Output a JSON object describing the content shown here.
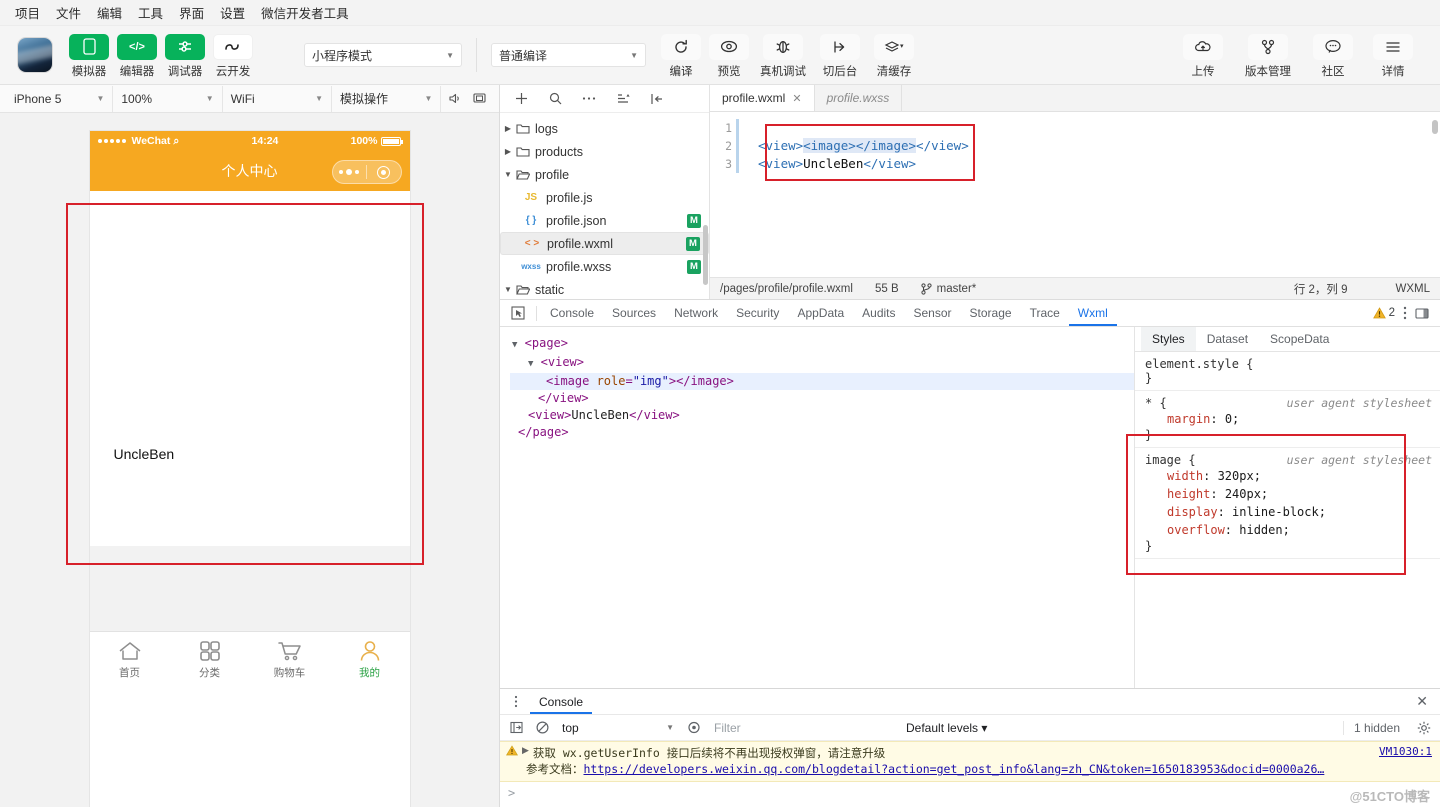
{
  "menubar": {
    "items": [
      "项目",
      "文件",
      "编辑",
      "工具",
      "界面",
      "设置",
      "微信开发者工具"
    ]
  },
  "toolbar": {
    "buttons": [
      {
        "label": "模拟器",
        "icon": "phone-icon",
        "style": "green"
      },
      {
        "label": "编辑器",
        "icon": "code-icon",
        "style": "green"
      },
      {
        "label": "调试器",
        "icon": "debugger-icon",
        "style": "green"
      },
      {
        "label": "云开发",
        "icon": "cloud-dev-icon",
        "style": "white"
      }
    ],
    "mode_select": "小程序模式",
    "compile_select": "普通编译",
    "actions": [
      {
        "label": "编译",
        "icon": "refresh-icon"
      },
      {
        "label": "预览",
        "icon": "eye-icon"
      },
      {
        "label": "真机调试",
        "icon": "remote-debug-icon"
      },
      {
        "label": "切后台",
        "icon": "background-icon"
      },
      {
        "label": "清缓存",
        "icon": "layers-icon"
      }
    ],
    "right_actions": [
      {
        "label": "上传",
        "icon": "upload-cloud-icon"
      },
      {
        "label": "版本管理",
        "icon": "branch-icon"
      },
      {
        "label": "社区",
        "icon": "chat-icon"
      },
      {
        "label": "详情",
        "icon": "menu-icon"
      }
    ]
  },
  "simulator": {
    "device": "iPhone 5",
    "zoom": "100%",
    "network": "WiFi",
    "operation": "模拟操作",
    "icons": [
      "volume-icon",
      "screen-icon"
    ],
    "phone": {
      "carrier": "WeChat",
      "time": "14:24",
      "battery": "100%",
      "nav_title": "个人中心",
      "body_text": "UncleBen",
      "tabs": [
        {
          "label": "首页",
          "icon": "home-icon",
          "active": false
        },
        {
          "label": "分类",
          "icon": "grid-icon",
          "active": false
        },
        {
          "label": "购物车",
          "icon": "cart-icon",
          "active": false
        },
        {
          "label": "我的",
          "icon": "user-icon",
          "active": true
        }
      ]
    }
  },
  "filetree": {
    "tools": [
      "plus-icon",
      "search-icon",
      "more-icon",
      "sort-icon",
      "collapse-icon"
    ],
    "nodes": [
      {
        "name": "logs",
        "type": "folder",
        "expanded": false,
        "depth": 1,
        "badge": ""
      },
      {
        "name": "products",
        "type": "folder",
        "expanded": false,
        "depth": 1,
        "badge": ""
      },
      {
        "name": "profile",
        "type": "folder",
        "expanded": true,
        "depth": 1,
        "badge": ""
      },
      {
        "name": "profile.js",
        "type": "js",
        "ext": "JS",
        "depth": 2,
        "badge": ""
      },
      {
        "name": "profile.json",
        "type": "json",
        "ext": "{ }",
        "depth": 2,
        "badge": "M"
      },
      {
        "name": "profile.wxml",
        "type": "wxml",
        "ext": "< >",
        "depth": 2,
        "badge": "M",
        "selected": true
      },
      {
        "name": "profile.wxss",
        "type": "wxss",
        "ext": "wxss",
        "depth": 2,
        "badge": "M"
      },
      {
        "name": "static",
        "type": "folder",
        "expanded": true,
        "depth": 0,
        "badge": ""
      }
    ]
  },
  "editor": {
    "tabs": [
      {
        "label": "profile.wxml",
        "active": true,
        "closable": true
      },
      {
        "label": "profile.wxss",
        "active": false,
        "preview": true
      }
    ],
    "lines": [
      {
        "no": "1",
        "text": ""
      },
      {
        "no": "2",
        "text": "<view><image></image></view>"
      },
      {
        "no": "3",
        "text": "<view>UncleBen</view>"
      }
    ],
    "status": {
      "path": "/pages/profile/profile.wxml",
      "size": "55 B",
      "branch": "master*",
      "cursor": "行 2，列 9",
      "language": "WXML"
    }
  },
  "devtools": {
    "tabs": [
      "Console",
      "Sources",
      "Network",
      "Security",
      "AppData",
      "Audits",
      "Sensor",
      "Storage",
      "Trace",
      "Wxml"
    ],
    "active_tab": "Wxml",
    "warning_count": "2",
    "dom": [
      {
        "indent": 0,
        "tri": "▼",
        "text": "<page>",
        "hl": false
      },
      {
        "indent": 1,
        "tri": "▼",
        "text": "<view>",
        "hl": false
      },
      {
        "indent": 2,
        "tri": "",
        "text": "<image role=\"img\"></image>",
        "hl": true,
        "attr": "role",
        "value": "\"img\""
      },
      {
        "indent": 1,
        "tri": "",
        "text": "</view>",
        "hl": false
      },
      {
        "indent": 1,
        "tri": "",
        "text": "<view>UncleBen</view>",
        "hl": false
      },
      {
        "indent": 0,
        "tri": "",
        "text": "</page>",
        "hl": false
      }
    ],
    "styles_tabs": [
      "Styles",
      "Dataset",
      "ScopeData"
    ],
    "styles_active": "Styles",
    "rules": [
      {
        "selector": "element.style {",
        "source": "",
        "props": [],
        "close": "}"
      },
      {
        "selector": "* {",
        "source": "user agent stylesheet",
        "props": [
          {
            "k": "margin",
            "v": "0;"
          }
        ],
        "close": "}"
      },
      {
        "selector": "image {",
        "source": "user agent stylesheet",
        "props": [
          {
            "k": "width",
            "v": "320px;"
          },
          {
            "k": "height",
            "v": "240px;"
          },
          {
            "k": "display",
            "v": "inline-block;"
          },
          {
            "k": "overflow",
            "v": "hidden;"
          }
        ],
        "close": "}",
        "highlighted": true
      }
    ]
  },
  "console": {
    "tab": "Console",
    "context": "top",
    "filter_placeholder": "Filter",
    "levels": "Default levels ▾",
    "hidden": "1 hidden",
    "message": {
      "title": "获取 wx.getUserInfo 接口后续将不再出现授权弹窗，请注意升级",
      "doc_prefix": "参考文档：",
      "url": "https://developers.weixin.qq.com/blogdetail?action=get_post_info&lang=zh_CN&token=1650183953&docid=0000a26…",
      "source": "VM1030:1"
    },
    "watermark": "@51CTO博客"
  },
  "colors": {
    "accent_green": "#07b25b",
    "phone_header": "#f6a821",
    "annotation_red": "#d7202a",
    "devtools_blue": "#1a73e8"
  }
}
